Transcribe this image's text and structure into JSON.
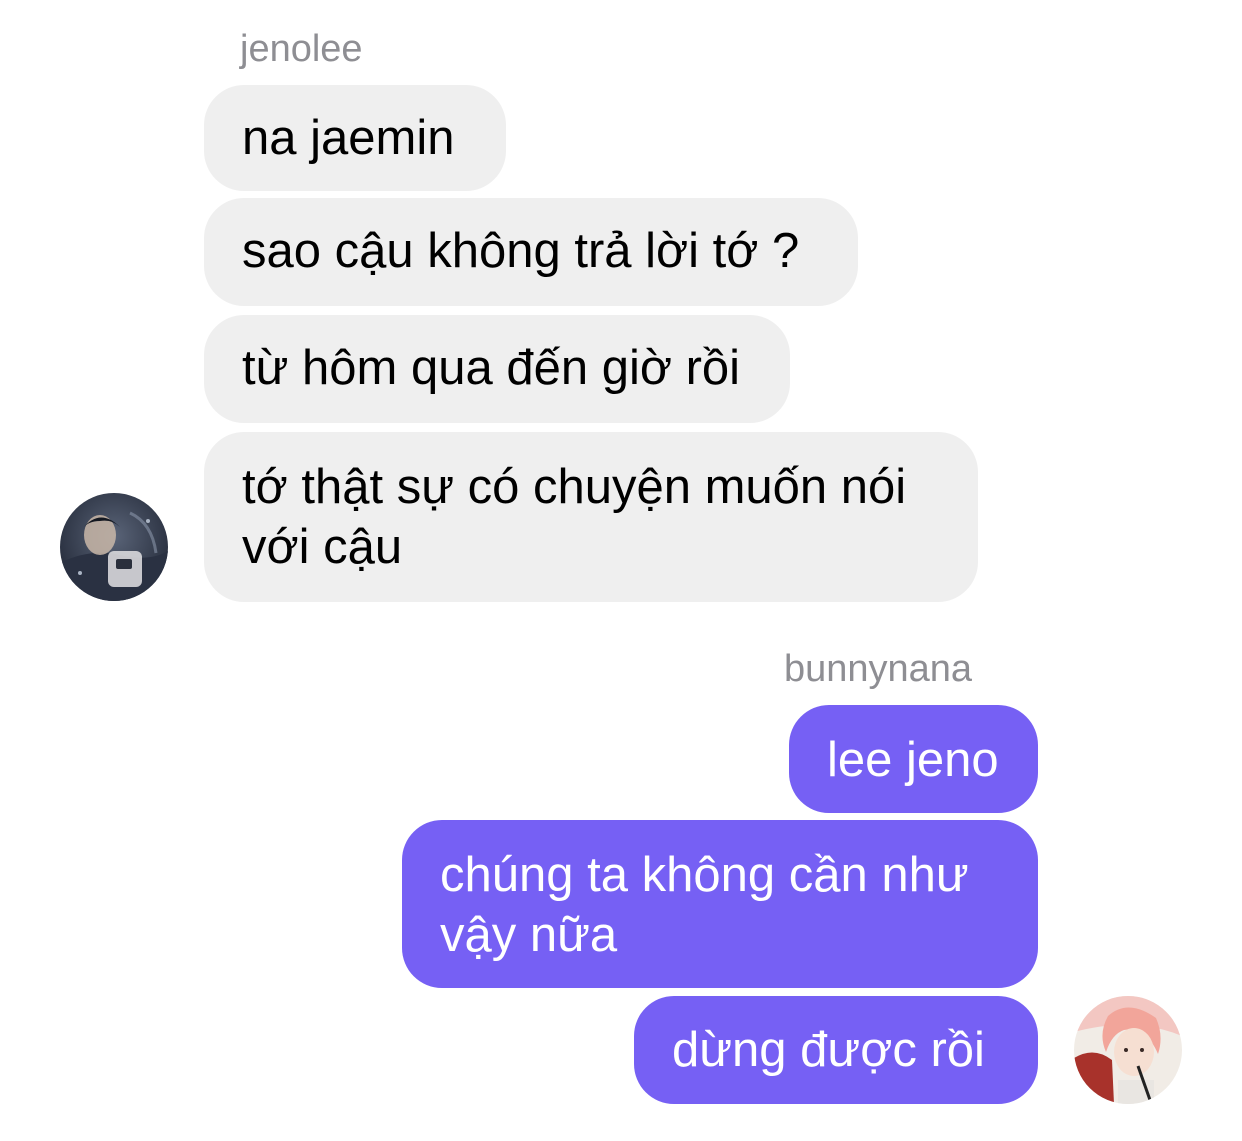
{
  "incoming": {
    "sender": "jenolee",
    "messages": [
      "na jaemin",
      "sao cậu không trả lời tớ ?",
      "từ hôm qua đến giờ rồi",
      "tớ thật sự có chuyện muốn nói với cậu"
    ],
    "avatar_icon": "user-avatar-photo"
  },
  "outgoing": {
    "sender": "bunnynana",
    "messages": [
      "lee jeno",
      "chúng ta không cần như vậy nữa",
      "dừng được rồi"
    ],
    "avatar_icon": "user-avatar-photo"
  },
  "colors": {
    "incoming_bubble": "#efefef",
    "outgoing_bubble": "#7660f4",
    "sender_name": "#8e8e93"
  }
}
